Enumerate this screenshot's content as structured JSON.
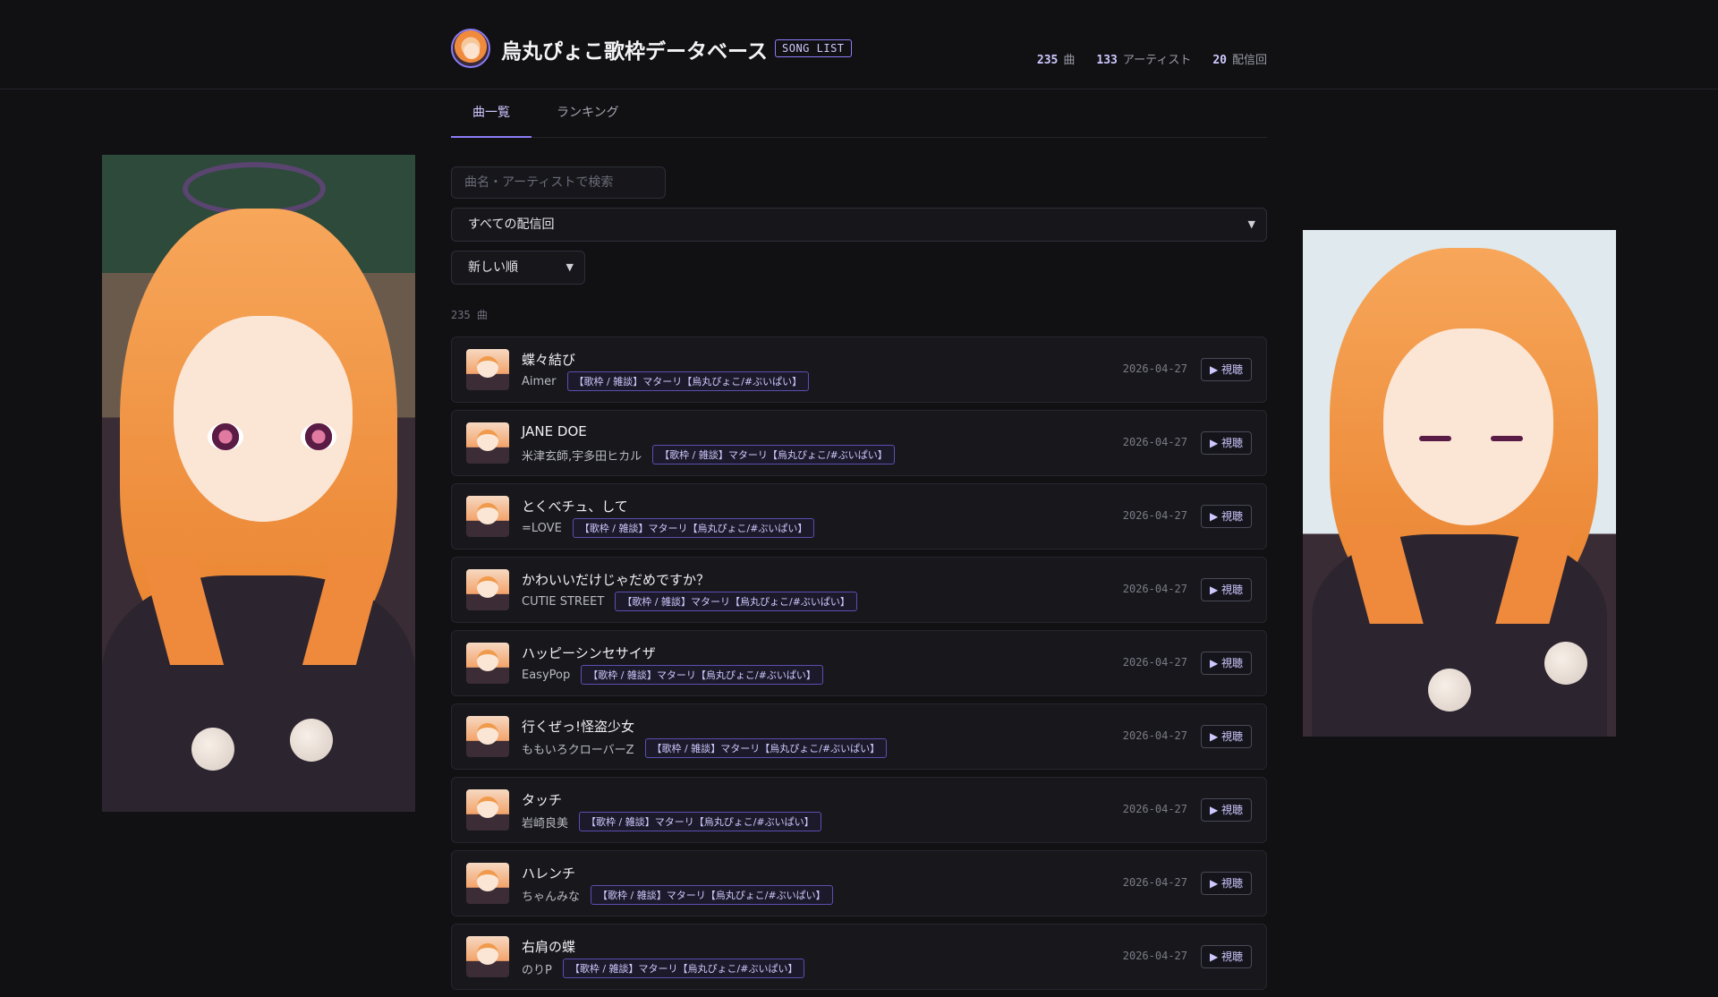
{
  "header": {
    "title": "烏丸ぴょこ歌枠データベース",
    "badge": "SONG LIST",
    "stats": [
      {
        "value": "235",
        "label": "曲"
      },
      {
        "value": "133",
        "label": "アーティスト"
      },
      {
        "value": "20",
        "label": "配信回"
      }
    ]
  },
  "tabs": [
    {
      "label": "曲一覧",
      "active": true
    },
    {
      "label": "ランキング",
      "active": false
    }
  ],
  "filters": {
    "search_placeholder": "曲名・アーティストで検索",
    "stream_select": "すべての配信回",
    "sort_select": "新しい順"
  },
  "result_count": "235 曲",
  "songs": [
    {
      "title": "蝶々結び",
      "artist": "Aimer",
      "stream": "【歌枠 / 雑談】マターリ【烏丸ぴょこ/#ぶいぱい】",
      "date": "2026-04-27",
      "play_label": "▶ 視聴"
    },
    {
      "title": "JANE DOE",
      "artist": "米津玄師,宇多田ヒカル",
      "stream": "【歌枠 / 雑談】マターリ【烏丸ぴょこ/#ぶいぱい】",
      "date": "2026-04-27",
      "play_label": "▶ 視聴"
    },
    {
      "title": "とくべチュ、して",
      "artist": "=LOVE",
      "stream": "【歌枠 / 雑談】マターリ【烏丸ぴょこ/#ぶいぱい】",
      "date": "2026-04-27",
      "play_label": "▶ 視聴"
    },
    {
      "title": "かわいいだけじゃだめですか？",
      "artist": "CUTIE STREET",
      "stream": "【歌枠 / 雑談】マターリ【烏丸ぴょこ/#ぶいぱい】",
      "date": "2026-04-27",
      "play_label": "▶ 視聴"
    },
    {
      "title": "ハッピーシンセサイザ",
      "artist": "EasyPop",
      "stream": "【歌枠 / 雑談】マターリ【烏丸ぴょこ/#ぶいぱい】",
      "date": "2026-04-27",
      "play_label": "▶ 視聴"
    },
    {
      "title": "行くぜっ!怪盗少女",
      "artist": "ももいろクローバーZ",
      "stream": "【歌枠 / 雑談】マターリ【烏丸ぴょこ/#ぶいぱい】",
      "date": "2026-04-27",
      "play_label": "▶ 視聴"
    },
    {
      "title": "タッチ",
      "artist": "岩崎良美",
      "stream": "【歌枠 / 雑談】マターリ【烏丸ぴょこ/#ぶいぱい】",
      "date": "2026-04-27",
      "play_label": "▶ 視聴"
    },
    {
      "title": "ハレンチ",
      "artist": "ちゃんみな",
      "stream": "【歌枠 / 雑談】マターリ【烏丸ぴょこ/#ぶいぱい】",
      "date": "2026-04-27",
      "play_label": "▶ 視聴"
    },
    {
      "title": "右肩の蝶",
      "artist": "のりP",
      "stream": "【歌枠 / 雑談】マターリ【烏丸ぴょこ/#ぶいぱい】",
      "date": "2026-04-27",
      "play_label": "▶ 視聴"
    }
  ],
  "icons": {
    "play": "play-icon",
    "dropdown": "chevron-down-icon"
  },
  "colors": {
    "background": "#111114",
    "accent": "#8b7cf6",
    "card": "#17171c"
  }
}
